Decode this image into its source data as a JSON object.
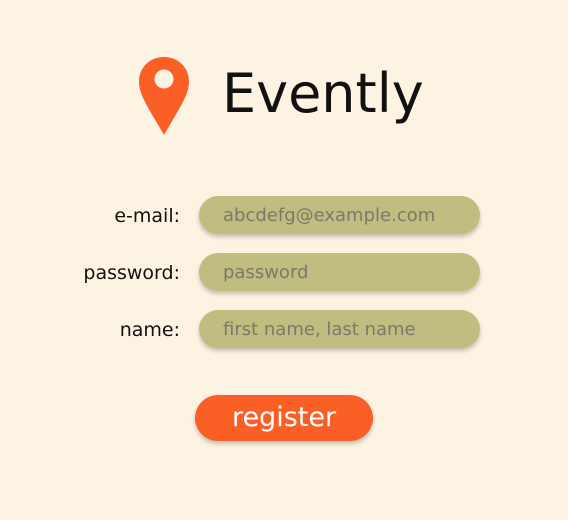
{
  "app": {
    "title": "Evently",
    "logo_icon": "map-pin-icon",
    "accent_color": "#fa5f26"
  },
  "form": {
    "email": {
      "label": "e-mail:",
      "placeholder": "abcdefg@example.com",
      "value": ""
    },
    "password": {
      "label": "password:",
      "placeholder": "password",
      "value": ""
    },
    "name": {
      "label": "name:",
      "placeholder": "first name, last name",
      "value": ""
    },
    "input_color": "#bfbd80"
  },
  "actions": {
    "register_label": "register"
  }
}
